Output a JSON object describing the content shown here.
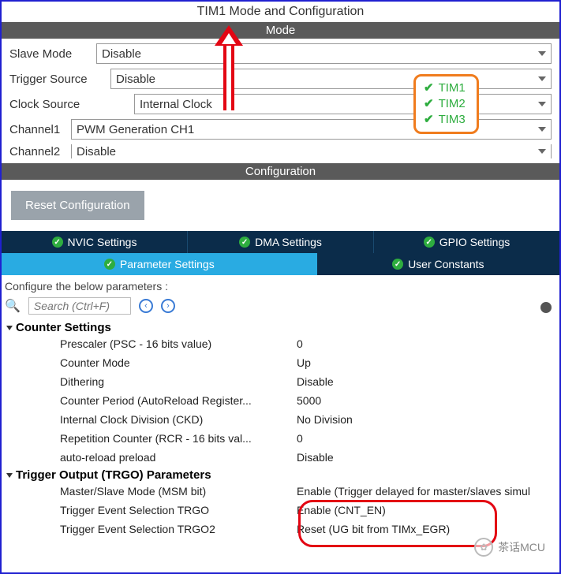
{
  "title": "TIM1 Mode and Configuration",
  "mode_header": "Mode",
  "config_header": "Configuration",
  "mode": {
    "slave_mode_label": "Slave Mode",
    "slave_mode_value": "Disable",
    "trigger_source_label": "Trigger Source",
    "trigger_source_value": "Disable",
    "clock_source_label": "Clock Source",
    "clock_source_value": "Internal Clock",
    "channel1_label": "Channel1",
    "channel1_value": "PWM Generation CH1",
    "channel2_label": "Channel2",
    "channel2_value": "Disable"
  },
  "reset_button": "Reset Configuration",
  "tabs": {
    "nvic": "NVIC Settings",
    "dma": "DMA Settings",
    "gpio": "GPIO Settings",
    "param": "Parameter Settings",
    "user": "User Constants"
  },
  "params_intro": "Configure the below parameters :",
  "search_placeholder": "Search (Ctrl+F)",
  "counter_group": "Counter Settings",
  "counter": [
    {
      "k": "Prescaler (PSC - 16 bits value)",
      "v": "0"
    },
    {
      "k": "Counter Mode",
      "v": "Up"
    },
    {
      "k": "Dithering",
      "v": "Disable"
    },
    {
      "k": "Counter Period (AutoReload Register...",
      "v": "5000"
    },
    {
      "k": "Internal Clock Division (CKD)",
      "v": "No Division"
    },
    {
      "k": "Repetition Counter (RCR - 16 bits val...",
      "v": "0"
    },
    {
      "k": "auto-reload preload",
      "v": "Disable"
    }
  ],
  "trgo_group": "Trigger Output (TRGO) Parameters",
  "trgo": [
    {
      "k": "Master/Slave Mode (MSM bit)",
      "v": "Enable (Trigger delayed for master/slaves simul"
    },
    {
      "k": "Trigger Event Selection TRGO",
      "v": "Enable (CNT_EN)"
    },
    {
      "k": "Trigger Event Selection TRGO2",
      "v": "Reset (UG bit from TIMx_EGR)"
    }
  ],
  "tim_list": [
    "TIM1",
    "TIM2",
    "TIM3"
  ],
  "watermark": "茶话MCU"
}
